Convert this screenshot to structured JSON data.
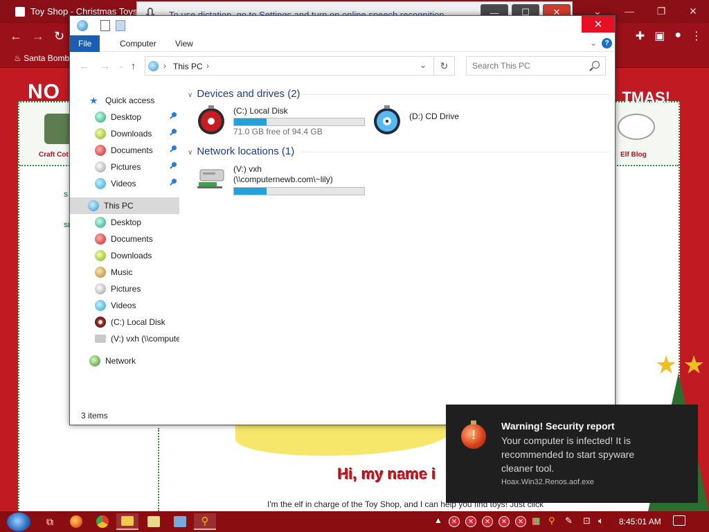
{
  "browser": {
    "tab_title": "Toy Shop - Christmas Toys, C",
    "bookmark": "Santa Bomb",
    "win_controls": [
      "⌄",
      "—",
      "❐",
      "✕"
    ]
  },
  "site": {
    "banner_left": "NO",
    "banner_right": "TMAS!",
    "nav_left": "Craft Cot",
    "nav_right": "Elf Blog",
    "side_s1": "S",
    "side_s2": "Sl",
    "greeting": "Hi, my name i",
    "intro": "I'm the elf in charge of the Toy Shop, and I can help you find toys! Just click"
  },
  "dictation": {
    "message": "To use dictation, go to Settings and turn on online speech recognition",
    "min": "—",
    "max": "☐",
    "close": "✕"
  },
  "explorer": {
    "close": "✕",
    "ribbon": {
      "file": "File",
      "computer": "Computer",
      "view": "View",
      "help": "?"
    },
    "address": {
      "path": "This PC",
      "search_placeholder": "Search This PC"
    },
    "nav": {
      "quick_access": "Quick access",
      "qa_items": [
        {
          "label": "Desktop",
          "icon": "desktop-icon"
        },
        {
          "label": "Downloads",
          "icon": "downloads-icon"
        },
        {
          "label": "Documents",
          "icon": "documents-icon"
        },
        {
          "label": "Pictures",
          "icon": "pictures-icon"
        },
        {
          "label": "Videos",
          "icon": "videos-icon"
        }
      ],
      "this_pc": "This PC",
      "pc_items": [
        {
          "label": "Desktop"
        },
        {
          "label": "Documents"
        },
        {
          "label": "Downloads"
        },
        {
          "label": "Music"
        },
        {
          "label": "Pictures"
        },
        {
          "label": "Videos"
        },
        {
          "label": "(C:) Local Disk"
        },
        {
          "label": "(V:) vxh (\\\\computernewb.com\\~lily)"
        }
      ],
      "network": "Network"
    },
    "groups": {
      "devices": "Devices and drives (2)",
      "network": "Network locations (1)"
    },
    "drives": {
      "c": {
        "name": "(C:) Local Disk",
        "free": "71.0 GB free of 94.4 GB",
        "used_fraction": 0.25
      },
      "d": {
        "name": "(D:) CD Drive"
      },
      "v": {
        "name": "(V:) vxh",
        "path": "(\\\\computernewb.com\\~lily)",
        "used_fraction": 0.25
      }
    },
    "status": "3 items"
  },
  "toast": {
    "title": "Warning! Security report",
    "body": "Your computer is infected! It is recommended to start spyware cleaner tool.",
    "source": "Hoax.Win32.Renos.aof.exe"
  },
  "taskbar": {
    "clock": "8:45:01 AM"
  },
  "colors": {
    "accent": "#1a5fb4",
    "toast_bg": "#1f1f1f",
    "site_red": "#c21a23",
    "drive_fill": "#26a0da",
    "close_red": "#e81123"
  }
}
